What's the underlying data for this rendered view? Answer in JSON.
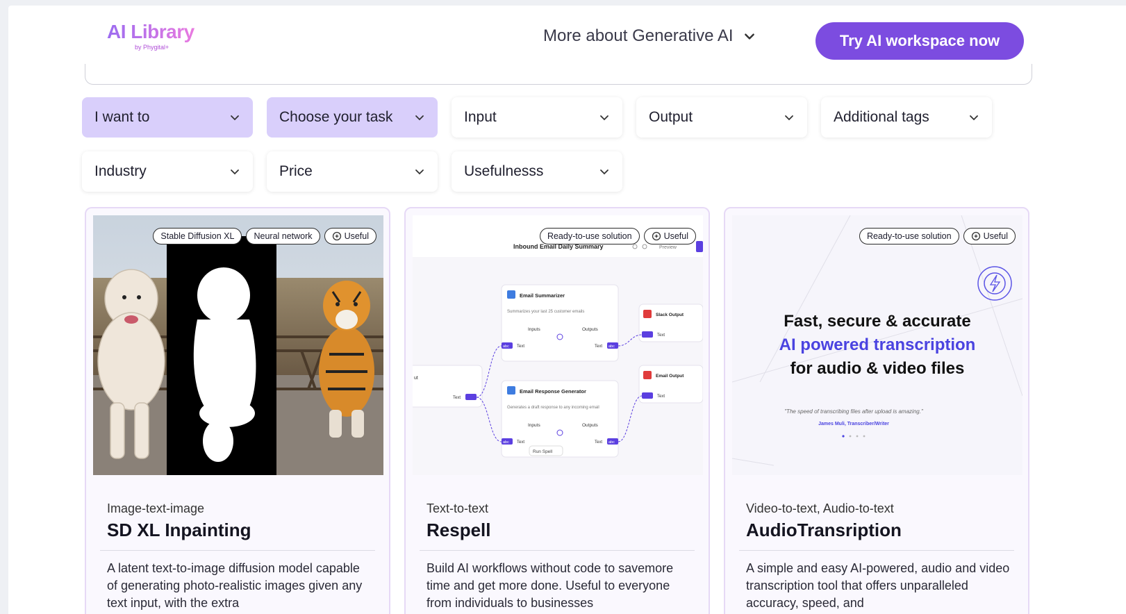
{
  "header": {
    "logo_main": "AI Library",
    "logo_sub": "by Phygital+",
    "more_label": "More about Generative AI",
    "cta_label": "Try AI workspace now"
  },
  "filters": {
    "row1": [
      "I want to",
      "Choose your task",
      "Input",
      "Output",
      "Additional tags"
    ],
    "row2": [
      "Industry",
      "Price",
      "Usefulnesss"
    ]
  },
  "cards": [
    {
      "tags": [
        "Stable Diffusion XL",
        "Neural network",
        "Useful"
      ],
      "category": "Image-text-image",
      "title": "SD XL Inpainting",
      "description": "A latent text-to-image diffusion model capable of generating photo-realistic images given any text input, with the extra"
    },
    {
      "tags": [
        "Ready-to-use solution",
        "Useful"
      ],
      "category": "Text-to-text",
      "title": "Respell",
      "description": "Build AI workflows without code to savemore time and get more done. Useful to everyone from individuals to businesses",
      "preview": {
        "title": "Inbound Email Daily Summary",
        "preview_label": "Preview",
        "node1_title": "Email Summarizer",
        "node1_desc": "Summarizes your last 25 customer emails",
        "node2_title": "Email Response Generator",
        "node2_desc": "Generates a draft response to any incoming email",
        "inputs": "Inputs",
        "outputs": "Outputs",
        "text": "Text",
        "abc": "abc",
        "slack": "Slack Output",
        "email_out": "Email Output",
        "run": "Run Spell",
        "left_label": "ut"
      }
    },
    {
      "tags": [
        "Ready-to-use solution",
        "Useful"
      ],
      "category": "Video-to-text, Audio-to-text",
      "title": "AudioTransription",
      "description": "A simple and easy AI-powered, audio and video transcription tool that offers unparalleled accuracy, speed, and",
      "preview": {
        "line1": "Fast, secure & accurate",
        "line2": "AI powered transcription",
        "line3": "for audio & video files",
        "quote": "\"The speed of transcribing files after upload is amazing.\"",
        "author": "James Muli, Transcriber/Writer"
      }
    }
  ],
  "colors": {
    "accent": "#7c4ce0",
    "filter_active": "#d9cffb",
    "transcription_blue": "#4a43e0"
  }
}
